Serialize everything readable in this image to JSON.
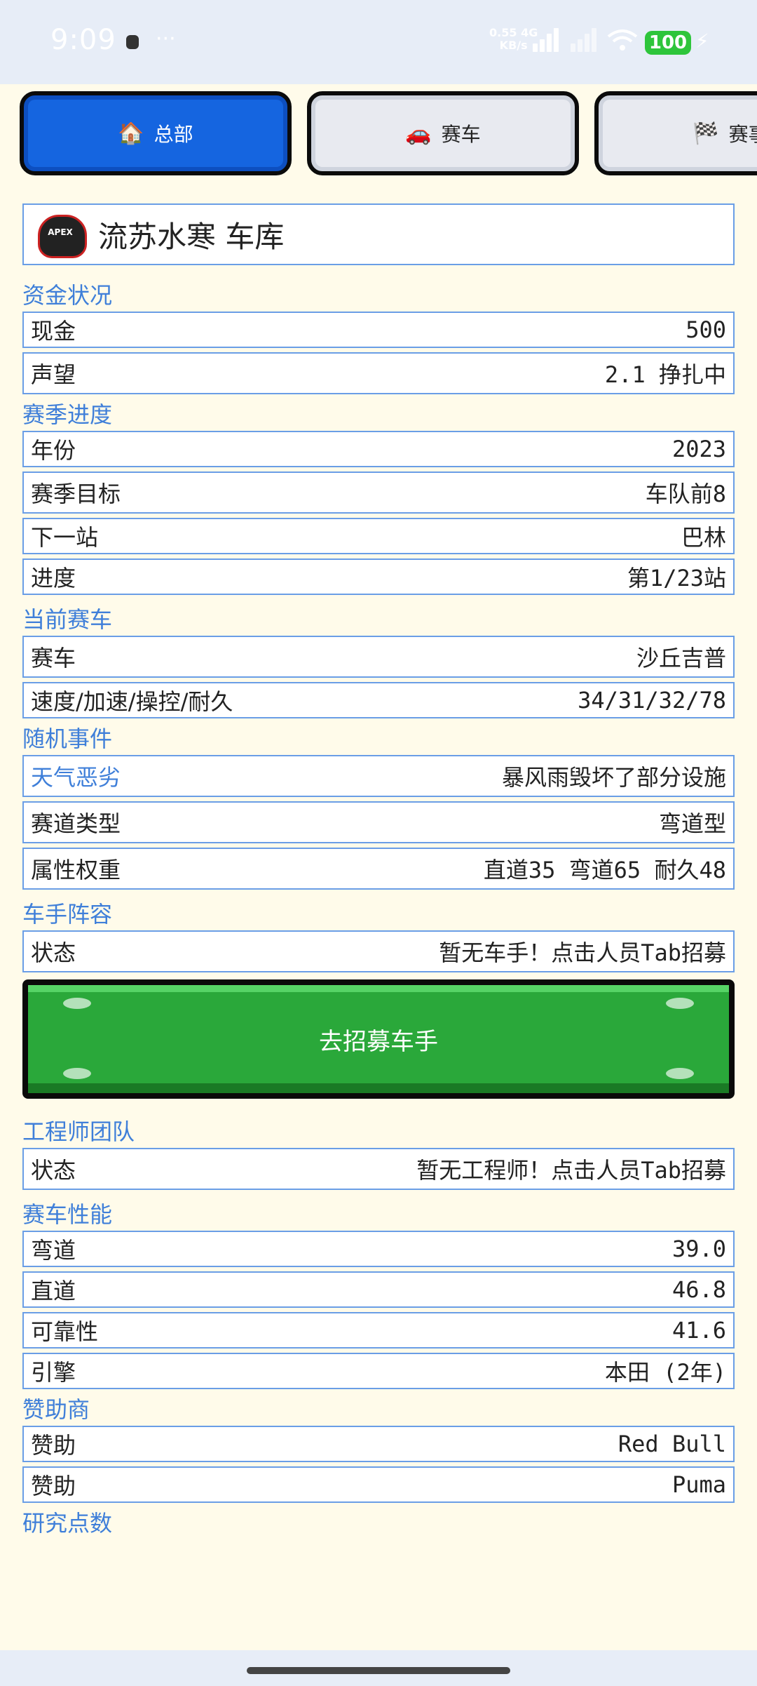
{
  "status_bar": {
    "time": "9:09",
    "more": "···",
    "speed_value": "0.55",
    "speed_unit": "KB/s",
    "network": "4G",
    "battery": "100"
  },
  "tabs": [
    {
      "icon": "🏠",
      "label": "总部",
      "active": true
    },
    {
      "icon": "🚗",
      "label": "赛车",
      "active": false
    },
    {
      "icon": "🏁",
      "label": "赛事",
      "active": false
    }
  ],
  "garage": {
    "logo_text": "APEX",
    "title": "流苏水寒  车库"
  },
  "sections": {
    "funds": {
      "title": "资金状况",
      "rows": [
        {
          "label": "现金",
          "value": "500"
        },
        {
          "label": "声望",
          "value": "2.1 挣扎中"
        }
      ]
    },
    "season": {
      "title": "赛季进度",
      "rows": [
        {
          "label": "年份",
          "value": "2023"
        },
        {
          "label": "赛季目标",
          "value": "车队前8"
        },
        {
          "label": "下一站",
          "value": "巴林"
        },
        {
          "label": "进度",
          "value": "第1/23站"
        }
      ]
    },
    "car": {
      "title": "当前赛车",
      "rows": [
        {
          "label": "赛车",
          "value": "沙丘吉普"
        },
        {
          "label": "速度/加速/操控/耐久",
          "value": "34/31/32/78"
        }
      ]
    },
    "events": {
      "title": "随机事件",
      "rows": [
        {
          "label": "天气恶劣",
          "value": "暴风雨毁坏了部分设施"
        },
        {
          "label": "赛道类型",
          "value": "弯道型"
        },
        {
          "label": "属性权重",
          "value": "直道35 弯道65 耐久48"
        }
      ]
    },
    "drivers": {
      "title": "车手阵容",
      "rows": [
        {
          "label": "状态",
          "value": "暂无车手！点击人员Tab招募"
        }
      ],
      "button": "去招募车手"
    },
    "engineers": {
      "title": "工程师团队",
      "rows": [
        {
          "label": "状态",
          "value": "暂无工程师！点击人员Tab招募"
        }
      ]
    },
    "performance": {
      "title": "赛车性能",
      "rows": [
        {
          "label": "弯道",
          "value": "39.0"
        },
        {
          "label": "直道",
          "value": "46.8"
        },
        {
          "label": "可靠性",
          "value": "41.6"
        },
        {
          "label": "引擎",
          "value": "本田 (2年)"
        }
      ]
    },
    "sponsors": {
      "title": "赞助商",
      "rows": [
        {
          "label": "赞助",
          "value": "Red Bull"
        },
        {
          "label": "赞助",
          "value": "Puma"
        }
      ]
    },
    "research": {
      "title": "研究点数"
    }
  }
}
